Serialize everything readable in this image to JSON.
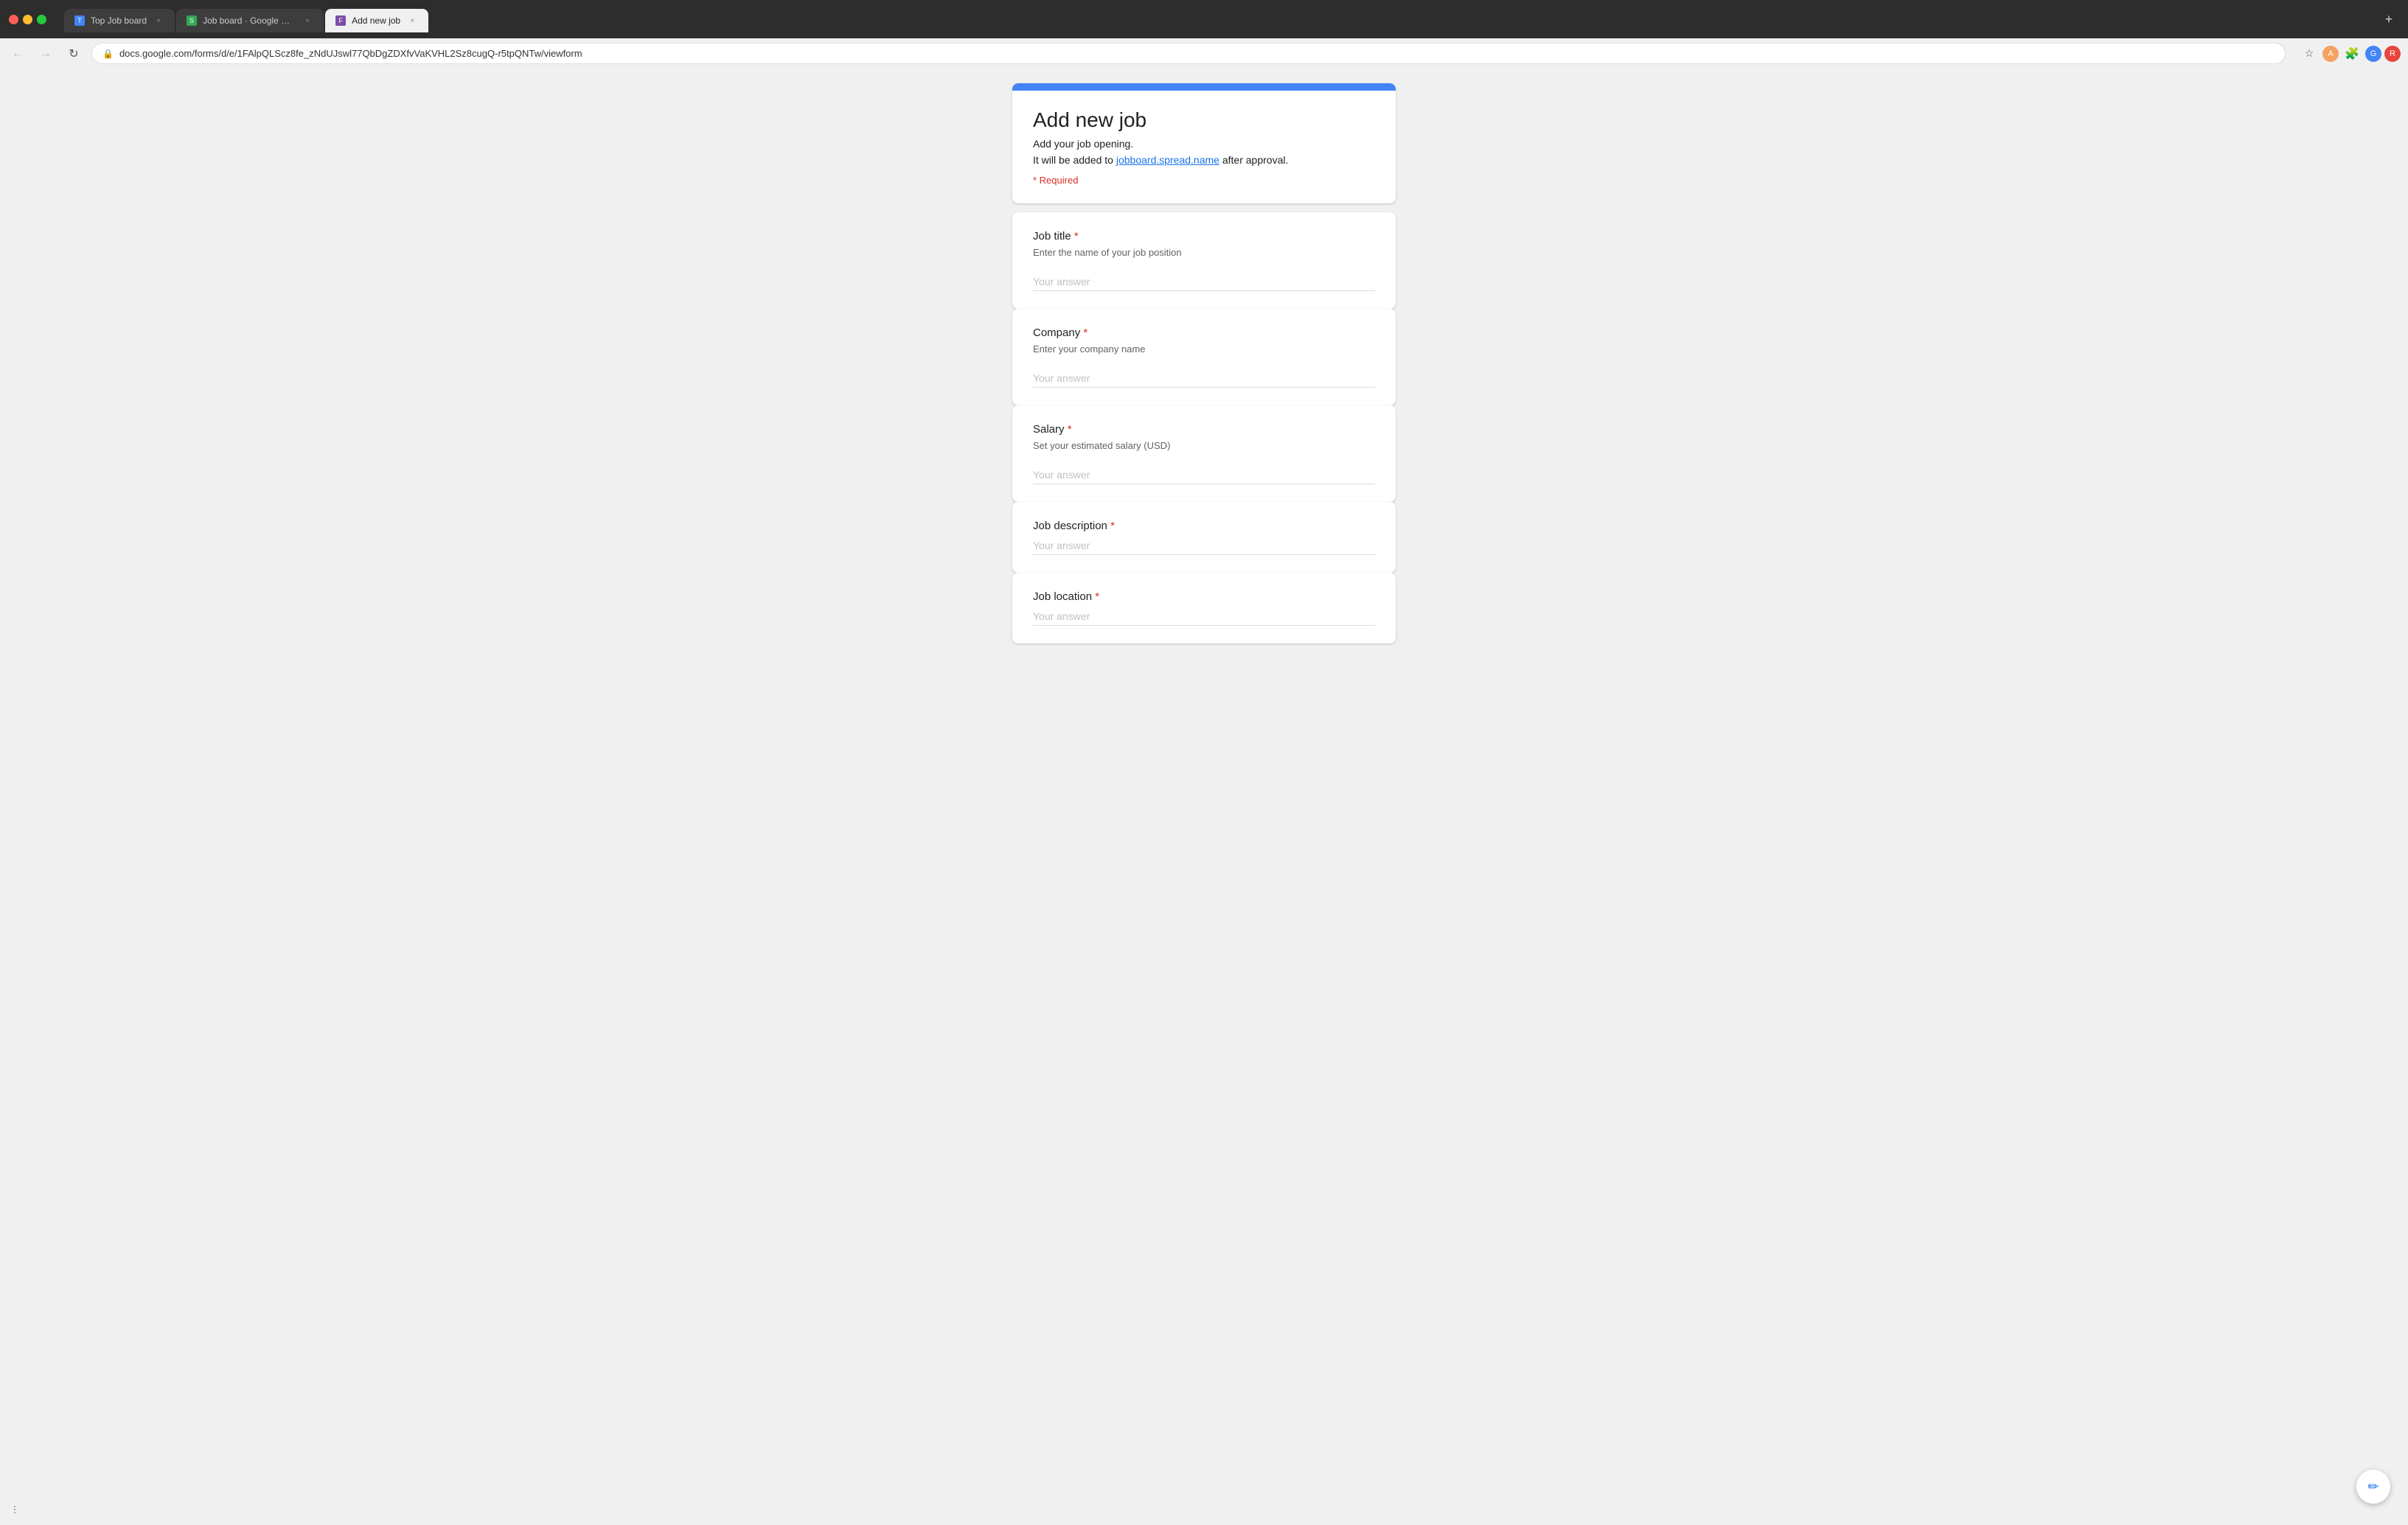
{
  "browser": {
    "tabs": [
      {
        "id": "tab-1",
        "label": "Top Job board",
        "favicon_type": "blue",
        "favicon_letter": "T",
        "active": false,
        "closeable": true
      },
      {
        "id": "tab-2",
        "label": "Job board · Google Sheets",
        "favicon_type": "green",
        "favicon_letter": "S",
        "active": false,
        "closeable": true
      },
      {
        "id": "tab-3",
        "label": "Add new job",
        "favicon_type": "purple",
        "favicon_letter": "F",
        "active": true,
        "closeable": true
      }
    ],
    "url": "docs.google.com/forms/d/e/1FAlpQLScz8fe_zNdUJswl77QbDgZDXfvVaKVHL2Sz8cugQ-r5tpQNTw/viewform"
  },
  "form": {
    "title": "Add new job",
    "description": "Add your job opening.",
    "link_prefix": "It will be added to ",
    "link_text": "jobboard.spread.name",
    "link_suffix": " after approval.",
    "required_note": "* Required",
    "header_color": "#4285f4",
    "fields": [
      {
        "id": "job-title",
        "label": "Job title",
        "required": true,
        "help": "Enter the name of your job position",
        "placeholder": "Your answer",
        "type": "text"
      },
      {
        "id": "company",
        "label": "Company",
        "required": true,
        "help": "Enter your company name",
        "placeholder": "Your answer",
        "type": "text"
      },
      {
        "id": "salary",
        "label": "Salary",
        "required": true,
        "help": "Set your estimated salary (USD)",
        "placeholder": "Your answer",
        "type": "text"
      },
      {
        "id": "job-description",
        "label": "Job description",
        "required": true,
        "help": "",
        "placeholder": "Your answer",
        "type": "text"
      },
      {
        "id": "job-location",
        "label": "Job location",
        "required": true,
        "help": "",
        "placeholder": "Your answer",
        "type": "text"
      }
    ]
  },
  "floating_button": {
    "icon": "✏"
  },
  "status_bar": {
    "icon": "⋮"
  }
}
